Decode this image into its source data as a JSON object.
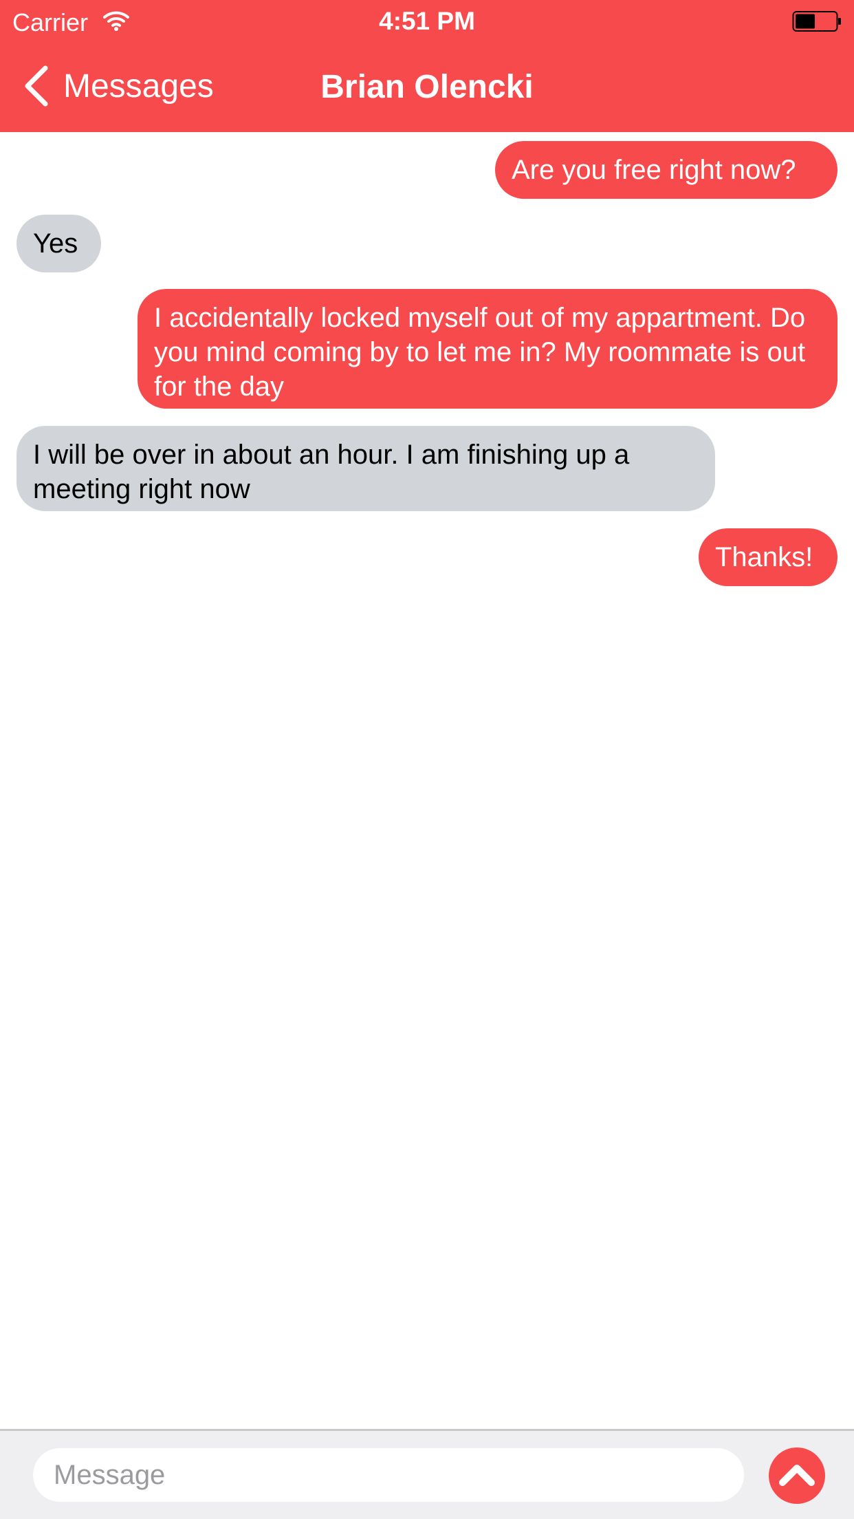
{
  "status_bar": {
    "carrier": "Carrier",
    "time": "4:51 PM",
    "wifi_icon": "wifi-icon",
    "battery_icon": "battery-icon"
  },
  "nav": {
    "back_label": "Messages",
    "back_icon": "chevron-left-icon",
    "title": "Brian Olencki"
  },
  "messages": [
    {
      "direction": "outgoing",
      "text": "Are you free right now?"
    },
    {
      "direction": "incoming",
      "text": "Yes"
    },
    {
      "direction": "outgoing",
      "text": "I accidentally locked myself out of my appartment. Do you mind coming by to let me in? My roommate is out for the day"
    },
    {
      "direction": "incoming",
      "text": "I will be over in about an hour. I am finishing up a meeting right now"
    },
    {
      "direction": "outgoing",
      "text": "Thanks!"
    }
  ],
  "composer": {
    "placeholder": "Message",
    "value": "",
    "send_icon": "chevron-up-icon"
  },
  "colors": {
    "accent": "#f74a4c",
    "incoming_bubble": "#d1d5d9",
    "composer_bg": "#efeff1"
  }
}
